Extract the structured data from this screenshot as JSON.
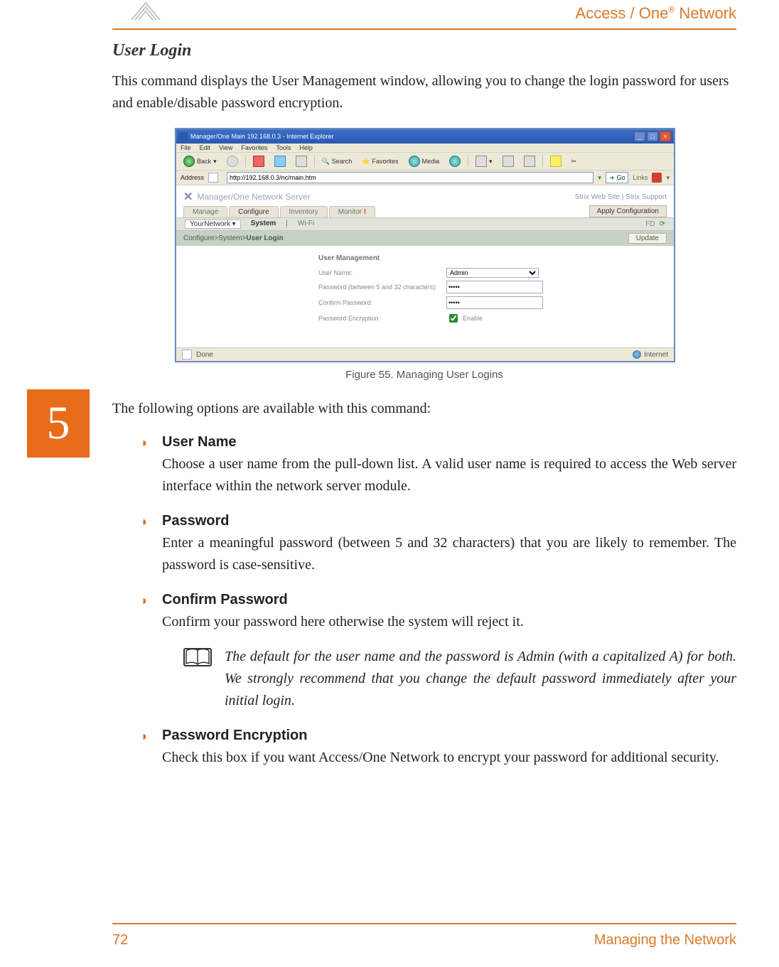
{
  "header": {
    "brand_prefix": "Access / One",
    "brand_reg": "®",
    "brand_suffix": " Network"
  },
  "content": {
    "title": "User Login",
    "intro": "This command displays the User Management window, allowing you to change the login password for users and enable/disable password encryption.",
    "caption": "Figure 55. Managing User Logins",
    "lead_in": "The following options are available with this command:",
    "bullets": [
      {
        "title": "User Name",
        "desc": "Choose a user name from the pull-down list. A valid user name is required to access the Web server interface within the network server module."
      },
      {
        "title": "Password",
        "desc": "Enter a meaningful password (between 5 and 32 characters) that you are likely to remember. The password is case-sensitive."
      },
      {
        "title": "Confirm Password",
        "desc": "Confirm your password here otherwise the system will reject it."
      },
      {
        "title": "Password Encryption",
        "desc": "Check this box if you want Access/One Network to encrypt your password for additional security."
      }
    ],
    "note": "The default for the user name and the password is Admin (with a capitalized A) for both. We strongly recommend that you change the default password immediately after your initial login."
  },
  "chapter_tab": "5",
  "footer": {
    "page_number": "72",
    "section": "Managing the Network"
  },
  "screenshot": {
    "window_title": "Manager/One Main 192.168.0.3 - Internet Explorer",
    "menus": [
      "File",
      "Edit",
      "View",
      "Favorites",
      "Tools",
      "Help"
    ],
    "toolbar": {
      "back": "Back",
      "search": "Search",
      "favorites": "Favorites",
      "media": "Media"
    },
    "address_label": "Address",
    "address_value": "http://192.168.0.3/nc/main.htm",
    "go": "Go",
    "links_label": "Links",
    "branding": "Manager/One Network Server",
    "right_links": "Strix Web Site  |  Strix Support",
    "tabs": [
      "Manage",
      "Configure",
      "Inventory",
      "Monitor"
    ],
    "apply": "Apply Configuration",
    "subtabs": {
      "net_label": "YourNetwork",
      "system": "System",
      "sep": "|",
      "wifi": "Wi-Fi",
      "fd": "FD"
    },
    "crumb": {
      "a": "Configure",
      "b": "System",
      "c": "User Login",
      "sep": " > ",
      "update": "Update"
    },
    "form": {
      "panel": "User Management",
      "user_label": "User Name:",
      "user_value": "Admin",
      "pw_label": "Password (between 5 and 32 characters):",
      "pw_value": "•••••",
      "cpw_label": "Confirm Password:",
      "cpw_value": "•••••",
      "enc_label": "Password Encryption:",
      "enc_checked": true,
      "enc_text": "Enable"
    },
    "status_done": "Done",
    "status_internet": "Internet"
  }
}
